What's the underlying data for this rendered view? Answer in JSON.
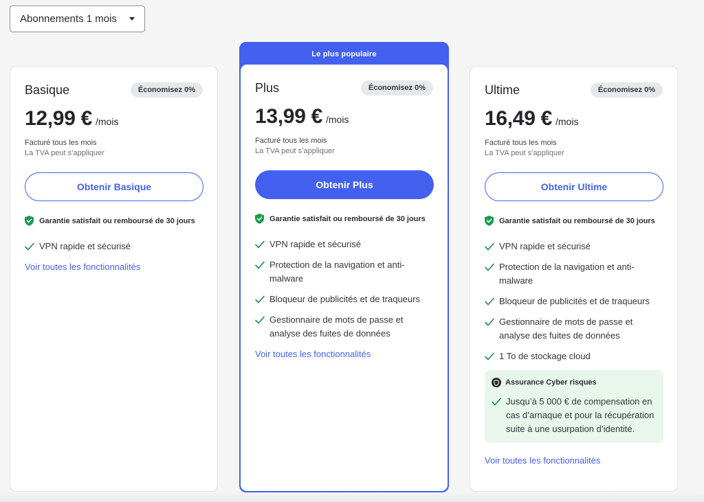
{
  "billing_select": {
    "value": "Abonnements 1 mois"
  },
  "popular_label": "Le plus populaire",
  "plans": [
    {
      "name": "Basique",
      "badge": "Économisez 0%",
      "price": "12,99 €",
      "per": "/mois",
      "billed": "Facturé tous les mois",
      "vat": "La TVA peut s’appliquer",
      "cta": "Obtenir Basique",
      "guarantee": "Garantie satisfait ou remboursé de 30 jours",
      "features": [
        "VPN rapide et sécurisé"
      ],
      "see_all": "Voir toutes les fonctionnalités"
    },
    {
      "name": "Plus",
      "badge": "Économisez 0%",
      "price": "13,99 €",
      "per": "/mois",
      "billed": "Facturé tous les mois",
      "vat": "La TVA peut s’appliquer",
      "cta": "Obtenir Plus",
      "guarantee": "Garantie satisfait ou remboursé de 30 jours",
      "features": [
        "VPN rapide et sécurisé",
        "Protection de la navigation et anti-malware",
        "Bloqueur de publicités et de traqueurs",
        "Gestionnaire de mots de passe et analyse des fuites de données"
      ],
      "see_all": "Voir toutes les fonctionnalités"
    },
    {
      "name": "Ultime",
      "badge": "Économisez 0%",
      "price": "16,49 €",
      "per": "/mois",
      "billed": "Facturé tous les mois",
      "vat": "La TVA peut s’appliquer",
      "cta": "Obtenir Ultime",
      "guarantee": "Garantie satisfait ou remboursé de 30 jours",
      "features": [
        "VPN rapide et sécurisé",
        "Protection de la navigation et anti-malware",
        "Bloqueur de publicités et de traqueurs",
        "Gestionnaire de mots de passe et analyse des fuites de données",
        "1 To de stockage cloud"
      ],
      "insurance": {
        "title": "Assurance Cyber risques",
        "text": "Jusqu’à 5 000 € de compensation en cas d’arnaque et pour la récupération suite à une usurpation d’identité."
      },
      "see_all": "Voir toutes les fonctionnalités"
    }
  ],
  "colors": {
    "accent": "#4361ee",
    "check": "#1f8a4c",
    "badge_bg": "#e7e8ec",
    "insurance_bg": "#e8f6ec"
  },
  "icons": {
    "dropdown": "caret-down-icon",
    "guarantee": "shield-check-icon",
    "feature": "check-icon",
    "insurance": "shield-icon"
  }
}
